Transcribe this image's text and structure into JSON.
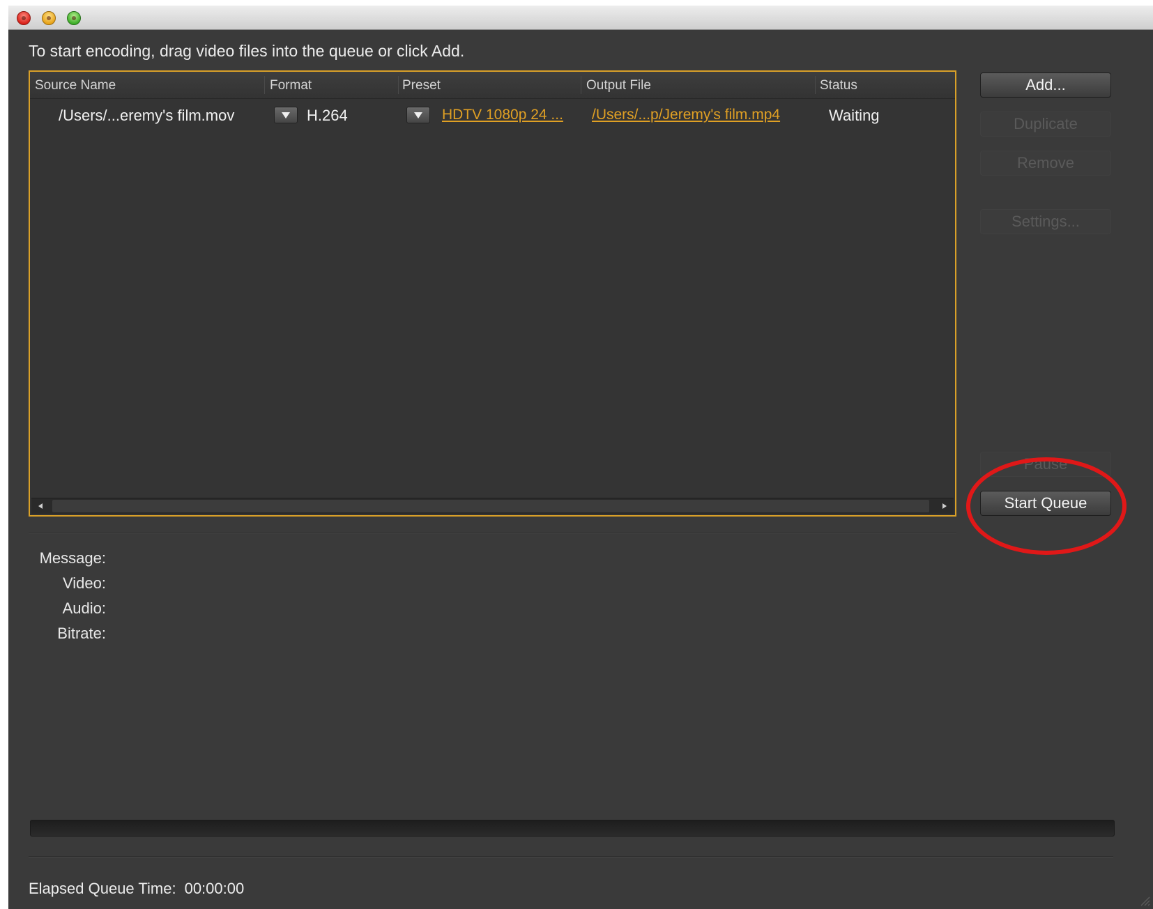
{
  "instructions": "To start encoding, drag video files into the queue or click Add.",
  "queue": {
    "columns": {
      "source": "Source Name",
      "format": "Format",
      "preset": "Preset",
      "output": "Output File",
      "status": "Status"
    },
    "items": [
      {
        "source": "/Users/...eremy's film.mov",
        "format": "H.264",
        "preset": "HDTV 1080p 24 ...",
        "output": "/Users/...p/Jeremy's film.mp4",
        "status": "Waiting"
      }
    ]
  },
  "buttons": {
    "add": "Add...",
    "duplicate": "Duplicate",
    "remove": "Remove",
    "settings": "Settings...",
    "pause": "Pause",
    "start_queue": "Start Queue"
  },
  "info": {
    "message_label": "Message:",
    "video_label": "Video:",
    "audio_label": "Audio:",
    "bitrate_label": "Bitrate:"
  },
  "progress": {
    "fraction": 0
  },
  "elapsed": {
    "label": "Elapsed Queue Time:",
    "value": "00:00:00"
  },
  "colors": {
    "background": "#3a3a3a",
    "accent": "#e0a024",
    "highlight": "#e01818"
  },
  "icons": {
    "close": "close-icon",
    "minimize": "minimize-icon",
    "zoom": "zoom-icon",
    "dropdown": "chevron-down-icon",
    "scroll_left": "arrow-left-icon",
    "scroll_right": "arrow-right-icon"
  }
}
